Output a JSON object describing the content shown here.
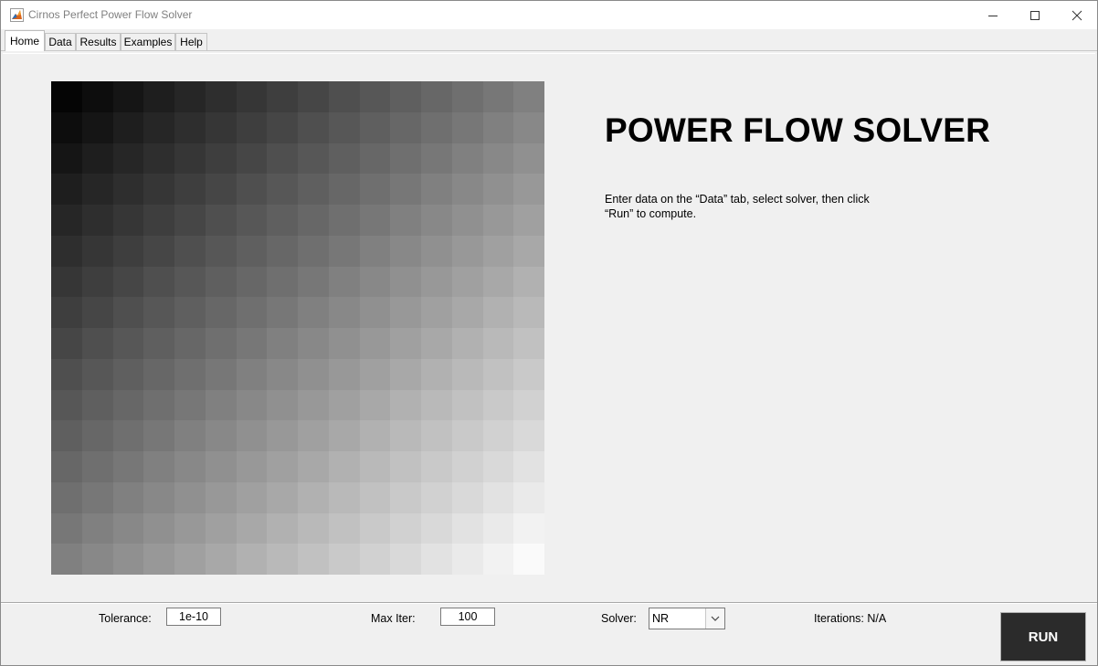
{
  "window": {
    "title": "Cirnos Perfect Power Flow Solver",
    "app_icon": "matlab-icon"
  },
  "tabs": [
    {
      "label": "Home",
      "active": true
    },
    {
      "label": "Data",
      "active": false
    },
    {
      "label": "Results",
      "active": false
    },
    {
      "label": "Examples",
      "active": false
    },
    {
      "label": "Help",
      "active": false
    }
  ],
  "home": {
    "title": "POWER FLOW SOLVER",
    "instructions_line1": "Enter data on the “Data” tab, select solver, then click",
    "instructions_line2": "“Run” to compute.",
    "image": {
      "type": "gradient-grid",
      "rows": 16,
      "cols": 16,
      "dark_color": "#050505",
      "light_color": "#fafafa"
    }
  },
  "controls": {
    "tolerance_label": "Tolerance:",
    "tolerance_value": "1e-10",
    "max_iter_label": "Max Iter:",
    "max_iter_value": "100",
    "solver_label": "Solver:",
    "solver_value": "NR",
    "iterations_label": "Iterations: N/A",
    "run_label": "RUN"
  },
  "colors": {
    "run_button_bg": "#2b2b2b",
    "background": "#f0f0f0"
  }
}
